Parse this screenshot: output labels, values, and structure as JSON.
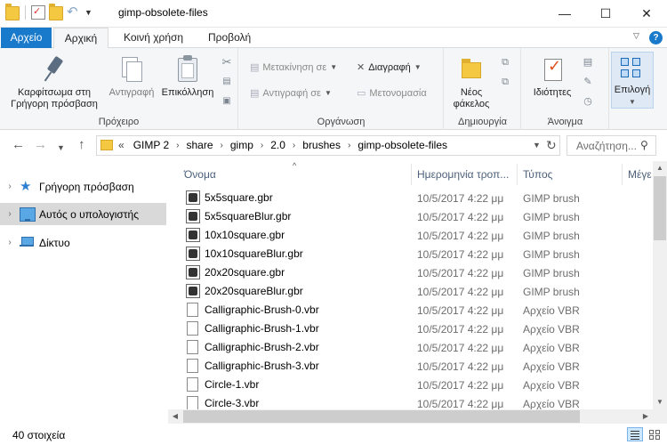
{
  "window": {
    "title": "gimp-obsolete-files",
    "minimize_glyph": "—",
    "maximize_glyph": "☐",
    "close_glyph": "✕"
  },
  "quick_access_toolbar": {
    "icons": [
      "folder-icon",
      "properties-icon",
      "new-folder-icon",
      "undo-icon",
      "customize-dropdown-icon"
    ]
  },
  "ribbon_tabs": [
    {
      "label": "Αρχείο"
    },
    {
      "label": "Αρχική"
    },
    {
      "label": "Κοινή χρήση"
    },
    {
      "label": "Προβολή"
    }
  ],
  "ribbon": {
    "clipboard": {
      "group_label": "Πρόχειρο",
      "pin_label": "Καρφίτσωμα στη Γρήγορη πρόσβαση",
      "copy_label": "Αντιγραφή",
      "paste_label": "Επικόλληση"
    },
    "organize": {
      "group_label": "Οργάνωση",
      "move_to_label": "Μετακίνηση σε",
      "copy_to_label": "Αντιγραφή σε",
      "delete_label": "Διαγραφή",
      "rename_label": "Μετονομασία"
    },
    "new": {
      "group_label": "Δημιουργία",
      "new_folder_label": "Νέος φάκελος"
    },
    "open": {
      "group_label": "Άνοιγμα",
      "properties_label": "Ιδιότητες"
    },
    "select": {
      "select_label": "Επιλογή"
    }
  },
  "address_bar": {
    "overflow": "«",
    "crumbs": [
      "GIMP 2",
      "share",
      "gimp",
      "2.0",
      "brushes",
      "gimp-obsolete-files"
    ],
    "search_placeholder": "Αναζήτηση..."
  },
  "navigation": {
    "items": [
      {
        "label": "Γρήγορη πρόσβαση",
        "icon": "star-icon",
        "selected": false
      },
      {
        "label": "Αυτός ο υπολογιστής",
        "icon": "computer-icon",
        "selected": true
      },
      {
        "label": "Δίκτυο",
        "icon": "network-icon",
        "selected": false
      }
    ]
  },
  "file_list": {
    "columns": [
      "Όνομα",
      "Ημερομηνία τροπ...",
      "Τύπος",
      "Μέγε"
    ],
    "rows": [
      {
        "name": "5x5square.gbr",
        "date": "10/5/2017 4:22 μμ",
        "type": "GIMP brush",
        "icon": "gimp-brush-icon"
      },
      {
        "name": "5x5squareBlur.gbr",
        "date": "10/5/2017 4:22 μμ",
        "type": "GIMP brush",
        "icon": "gimp-brush-icon"
      },
      {
        "name": "10x10square.gbr",
        "date": "10/5/2017 4:22 μμ",
        "type": "GIMP brush",
        "icon": "gimp-brush-icon"
      },
      {
        "name": "10x10squareBlur.gbr",
        "date": "10/5/2017 4:22 μμ",
        "type": "GIMP brush",
        "icon": "gimp-brush-icon"
      },
      {
        "name": "20x20square.gbr",
        "date": "10/5/2017 4:22 μμ",
        "type": "GIMP brush",
        "icon": "gimp-brush-icon"
      },
      {
        "name": "20x20squareBlur.gbr",
        "date": "10/5/2017 4:22 μμ",
        "type": "GIMP brush",
        "icon": "gimp-brush-icon"
      },
      {
        "name": "Calligraphic-Brush-0.vbr",
        "date": "10/5/2017 4:22 μμ",
        "type": "Αρχείο VBR",
        "icon": "file-icon"
      },
      {
        "name": "Calligraphic-Brush-1.vbr",
        "date": "10/5/2017 4:22 μμ",
        "type": "Αρχείο VBR",
        "icon": "file-icon"
      },
      {
        "name": "Calligraphic-Brush-2.vbr",
        "date": "10/5/2017 4:22 μμ",
        "type": "Αρχείο VBR",
        "icon": "file-icon"
      },
      {
        "name": "Calligraphic-Brush-3.vbr",
        "date": "10/5/2017 4:22 μμ",
        "type": "Αρχείο VBR",
        "icon": "file-icon"
      },
      {
        "name": "Circle-1.vbr",
        "date": "10/5/2017 4:22 μμ",
        "type": "Αρχείο VBR",
        "icon": "file-icon"
      },
      {
        "name": "Circle-3.vbr",
        "date": "10/5/2017 4:22 μμ",
        "type": "Αρχείο VBR",
        "icon": "file-icon"
      }
    ]
  },
  "status_bar": {
    "item_count": "40 στοιχεία"
  },
  "colors": {
    "accent": "#1979ca",
    "selected_nav": "#d9d9d9",
    "column_header_text": "#4c607a"
  }
}
